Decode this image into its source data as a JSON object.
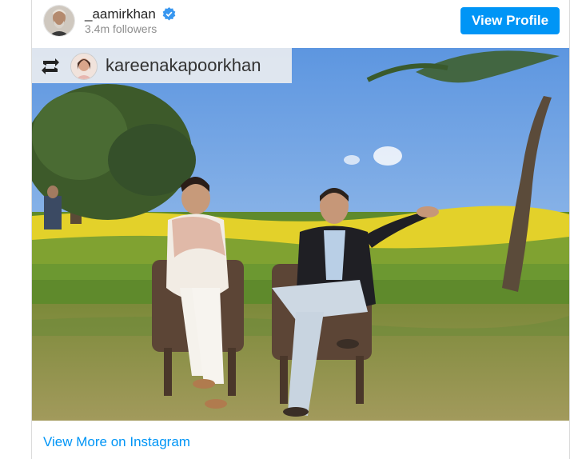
{
  "header": {
    "username": "_aamirkhan",
    "followers": "3.4m followers",
    "view_profile_label": "View Profile"
  },
  "post": {
    "repost_username": "kareenakapoorkhan"
  },
  "footer": {
    "view_more_label": "View More on Instagram"
  },
  "colors": {
    "accent": "#0095f6",
    "verified_badge": "#3897f0"
  }
}
